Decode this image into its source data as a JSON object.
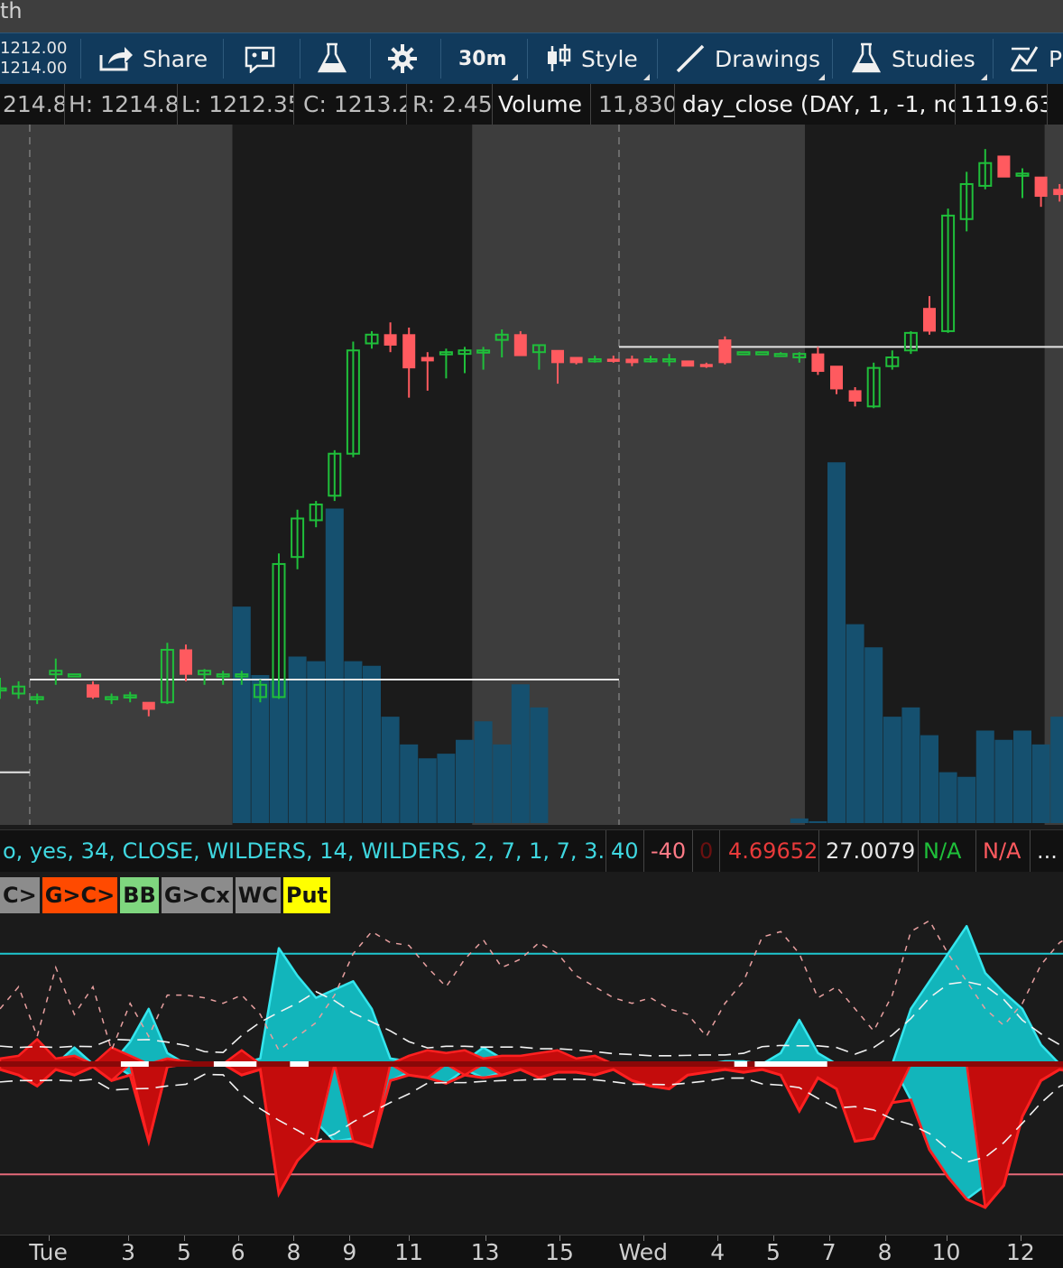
{
  "window": {
    "title_fragment": "th"
  },
  "toolbar": {
    "bid": "1212.00",
    "ask": "1214.00",
    "share_label": "Share",
    "timeframe_label": "30m",
    "style_label": "Style",
    "drawings_label": "Drawings",
    "studies_label": "Studies",
    "overflow_label": "P"
  },
  "info_bar": {
    "open": "214.8",
    "high": "H: 1214.8",
    "low": "L: 1212.35",
    "close": "C: 1213.2",
    "range": "R: 2.45",
    "volume_label": "Volume",
    "volume_value": "11,830",
    "study_label": "day_close (DAY, 1, -1, no)",
    "study_value": "1119.63"
  },
  "study_bar": {
    "params": "o, yes, 34, CLOSE, WILDERS, 14, WILDERS, 2, 7, 1, 7, 3.5, r",
    "v1": "40",
    "v2": "-40",
    "v3": "0",
    "v4": "4.69652",
    "v5": "27.0079",
    "v6": "N/A",
    "v7": "N/A",
    "more": "..."
  },
  "signal_labels": [
    {
      "text": "C>",
      "color": "#8c8c8c"
    },
    {
      "text": "G>C>",
      "color": "#ff4a00"
    },
    {
      "text": "BB",
      "color": "#7fd67f"
    },
    {
      "text": "G>Cx",
      "color": "#8c8c8c"
    },
    {
      "text": "WC",
      "color": "#8c8c8c"
    },
    {
      "text": "Put",
      "color": "#ffff00"
    }
  ],
  "icons": [
    "share-icon",
    "message-icon",
    "flask-icon",
    "gear-icon",
    "style-icon",
    "drawings-icon",
    "studies-icon",
    "pattern-icon"
  ],
  "colors": {
    "up": "#1fbf3a",
    "down": "#ff5a5f",
    "volume": "#15506f",
    "session_light": "#3d3d3d",
    "session_dark": "#1b1b1b",
    "osc_cyan": "#12b5bb",
    "osc_red": "#c40c0c",
    "upper_line": "#1ec8d0",
    "lower_line": "#e56a7a",
    "toolbar": "#113a5c"
  },
  "chart_data": {
    "type": "candlestick",
    "interval": "30m",
    "x_ticks": [
      "Tue",
      "3",
      "5",
      "6",
      "8",
      "9",
      "11",
      "13",
      "15",
      "Wed",
      "4",
      "5",
      "7",
      "8",
      "10",
      "12"
    ],
    "price_range": [
      1180,
      1220
    ],
    "reference_lines": [
      {
        "name": "day_close",
        "value": 1119.63
      }
    ],
    "candles": [
      {
        "o": 1187.8,
        "h": 1188.4,
        "l": 1187.2,
        "c": 1187.8
      },
      {
        "o": 1187.5,
        "h": 1188.2,
        "l": 1187.2,
        "c": 1187.9
      },
      {
        "o": 1187.3,
        "h": 1187.5,
        "l": 1186.9,
        "c": 1187.3
      },
      {
        "o": 1188.6,
        "h": 1189.5,
        "l": 1188.0,
        "c": 1188.8
      },
      {
        "o": 1188.6,
        "h": 1188.6,
        "l": 1188.6,
        "c": 1188.6
      },
      {
        "o": 1188.0,
        "h": 1188.2,
        "l": 1187.2,
        "c": 1187.3
      },
      {
        "o": 1187.3,
        "h": 1187.5,
        "l": 1186.9,
        "c": 1187.3
      },
      {
        "o": 1187.3,
        "h": 1187.6,
        "l": 1187.0,
        "c": 1187.4
      },
      {
        "o": 1187.0,
        "h": 1187.0,
        "l": 1186.2,
        "c": 1186.6
      },
      {
        "o": 1187.0,
        "h": 1190.4,
        "l": 1186.9,
        "c": 1190.0
      },
      {
        "o": 1190.0,
        "h": 1190.3,
        "l": 1188.2,
        "c": 1188.6
      },
      {
        "o": 1188.6,
        "h": 1188.9,
        "l": 1188.0,
        "c": 1188.8
      },
      {
        "o": 1188.6,
        "h": 1188.8,
        "l": 1188.0,
        "c": 1188.6
      },
      {
        "o": 1188.6,
        "h": 1188.8,
        "l": 1188.0,
        "c": 1188.6
      },
      {
        "o": 1187.3,
        "h": 1188.3,
        "l": 1187.0,
        "c": 1188.0
      },
      {
        "o": 1187.3,
        "h": 1195.5,
        "l": 1187.2,
        "c": 1194.9
      },
      {
        "o": 1195.3,
        "h": 1198.0,
        "l": 1194.6,
        "c": 1197.5
      },
      {
        "o": 1197.4,
        "h": 1198.5,
        "l": 1197.0,
        "c": 1198.3
      },
      {
        "o": 1198.8,
        "h": 1201.4,
        "l": 1198.5,
        "c": 1201.2
      },
      {
        "o": 1201.2,
        "h": 1207.6,
        "l": 1201.0,
        "c": 1207.1
      },
      {
        "o": 1207.5,
        "h": 1208.2,
        "l": 1207.2,
        "c": 1208.0
      },
      {
        "o": 1208.0,
        "h": 1208.7,
        "l": 1207.0,
        "c": 1207.4
      },
      {
        "o": 1208.0,
        "h": 1208.4,
        "l": 1204.4,
        "c": 1206.1
      },
      {
        "o": 1206.7,
        "h": 1207.0,
        "l": 1204.8,
        "c": 1206.5
      },
      {
        "o": 1206.9,
        "h": 1207.2,
        "l": 1205.5,
        "c": 1207.0
      },
      {
        "o": 1206.9,
        "h": 1207.3,
        "l": 1205.8,
        "c": 1207.1
      },
      {
        "o": 1207.0,
        "h": 1207.3,
        "l": 1206.0,
        "c": 1207.1
      },
      {
        "o": 1207.7,
        "h": 1208.3,
        "l": 1206.7,
        "c": 1208.0
      },
      {
        "o": 1208.0,
        "h": 1208.2,
        "l": 1206.8,
        "c": 1206.8
      },
      {
        "o": 1207.0,
        "h": 1207.4,
        "l": 1206.0,
        "c": 1207.4
      },
      {
        "o": 1207.1,
        "h": 1207.1,
        "l": 1205.2,
        "c": 1206.4
      },
      {
        "o": 1206.7,
        "h": 1206.7,
        "l": 1206.3,
        "c": 1206.4
      },
      {
        "o": 1206.6,
        "h": 1206.8,
        "l": 1206.4,
        "c": 1206.6
      },
      {
        "o": 1206.6,
        "h": 1206.8,
        "l": 1206.4,
        "c": 1206.5
      },
      {
        "o": 1206.6,
        "h": 1206.8,
        "l": 1206.2,
        "c": 1206.4
      },
      {
        "o": 1206.6,
        "h": 1206.8,
        "l": 1206.4,
        "c": 1206.6
      },
      {
        "o": 1206.5,
        "h": 1206.9,
        "l": 1206.2,
        "c": 1206.6
      },
      {
        "o": 1206.5,
        "h": 1206.5,
        "l": 1206.2,
        "c": 1206.2
      },
      {
        "o": 1206.3,
        "h": 1206.4,
        "l": 1206.1,
        "c": 1206.2
      },
      {
        "o": 1207.7,
        "h": 1207.9,
        "l": 1206.3,
        "c": 1206.4
      },
      {
        "o": 1207.0,
        "h": 1207.0,
        "l": 1207.0,
        "c": 1207.0
      },
      {
        "o": 1207.0,
        "h": 1207.0,
        "l": 1207.0,
        "c": 1207.0
      },
      {
        "o": 1206.9,
        "h": 1207.0,
        "l": 1206.9,
        "c": 1206.9
      },
      {
        "o": 1206.7,
        "h": 1207.0,
        "l": 1206.4,
        "c": 1206.9
      },
      {
        "o": 1206.9,
        "h": 1207.3,
        "l": 1205.7,
        "c": 1205.9
      },
      {
        "o": 1206.2,
        "h": 1206.2,
        "l": 1204.6,
        "c": 1204.9
      },
      {
        "o": 1204.8,
        "h": 1205.0,
        "l": 1203.9,
        "c": 1204.2
      },
      {
        "o": 1203.9,
        "h": 1206.4,
        "l": 1203.8,
        "c": 1206.1
      },
      {
        "o": 1206.2,
        "h": 1207.1,
        "l": 1206.0,
        "c": 1206.7
      },
      {
        "o": 1207.1,
        "h": 1208.2,
        "l": 1206.9,
        "c": 1208.1
      },
      {
        "o": 1209.5,
        "h": 1210.2,
        "l": 1208.0,
        "c": 1208.2
      },
      {
        "o": 1208.2,
        "h": 1215.2,
        "l": 1208.1,
        "c": 1214.8
      },
      {
        "o": 1214.6,
        "h": 1217.3,
        "l": 1213.9,
        "c": 1216.6
      },
      {
        "o": 1216.5,
        "h": 1218.6,
        "l": 1216.3,
        "c": 1217.8
      },
      {
        "o": 1218.2,
        "h": 1218.2,
        "l": 1217.0,
        "c": 1217.0
      },
      {
        "o": 1217.2,
        "h": 1217.5,
        "l": 1215.8,
        "c": 1217.2
      },
      {
        "o": 1217.0,
        "h": 1217.0,
        "l": 1215.3,
        "c": 1215.9
      },
      {
        "o": 1216.3,
        "h": 1216.6,
        "l": 1215.6,
        "c": 1216.0
      },
      {
        "o": 1216.5,
        "h": 1216.9,
        "l": 1215.2,
        "c": 1215.9
      },
      {
        "o": 1216.2,
        "h": 1216.3,
        "l": 1214.4,
        "c": 1214.6
      },
      {
        "o": 1214.8,
        "h": 1215.0,
        "l": 1213.6,
        "c": 1214.4
      },
      {
        "o": 1214.3,
        "h": 1216.9,
        "l": 1214.3,
        "c": 1216.5
      },
      {
        "o": 1216.3,
        "h": 1216.7,
        "l": 1215.7,
        "c": 1215.9
      },
      {
        "o": 1216.1,
        "h": 1216.4,
        "l": 1214.9,
        "c": 1216.0
      },
      {
        "o": 1216.2,
        "h": 1216.4,
        "l": 1215.1,
        "c": 1215.5
      },
      {
        "o": 1215.5,
        "h": 1215.8,
        "l": 1215.0,
        "c": 1215.2
      }
    ],
    "volume": [
      0,
      0,
      0,
      0,
      0,
      0,
      0,
      0,
      0,
      0,
      0,
      0,
      0,
      0,
      0,
      0,
      0,
      0,
      0,
      0,
      0,
      0,
      0,
      0,
      0,
      0,
      0,
      0,
      0,
      0,
      0,
      0,
      0,
      0,
      0,
      0,
      0,
      0,
      0,
      0,
      0,
      0,
      0,
      0,
      0,
      0,
      0,
      0,
      0,
      0,
      0,
      0,
      0,
      0,
      0,
      0,
      0,
      0,
      0,
      0,
      0,
      0,
      0,
      0,
      0,
      0
    ],
    "volume_visible": [
      2,
      3,
      0,
      0,
      0,
      0,
      2,
      2,
      3,
      0,
      1,
      0,
      0,
      1,
      3,
      3,
      2,
      3,
      2,
      8,
      4,
      0,
      2,
      1,
      0,
      2,
      1,
      1,
      1,
      0,
      3,
      1,
      1,
      0,
      4,
      3,
      2,
      0,
      0,
      0,
      0,
      0,
      0,
      0,
      0,
      0,
      0,
      0,
      0,
      0,
      0,
      0,
      0,
      0,
      0,
      0,
      0,
      0,
      0,
      0,
      0,
      0,
      0,
      0,
      0,
      0
    ],
    "oscillator": {
      "upper_level": 40,
      "lower_level": -40,
      "zero": 0,
      "range": [
        -55,
        55
      ],
      "cyan": [
        0,
        0,
        5,
        0,
        6,
        0,
        0,
        8,
        20,
        4,
        0,
        0,
        0,
        0,
        2,
        42,
        32,
        24,
        27,
        30,
        20,
        2,
        1,
        0,
        1,
        1,
        6,
        2,
        0,
        0,
        0,
        0,
        0,
        0,
        0,
        0,
        0,
        0,
        0,
        1,
        1,
        0,
        4,
        16,
        4,
        0,
        0,
        0,
        0,
        20,
        30,
        40,
        50,
        33,
        26,
        20,
        7,
        0,
        0,
        0,
        2,
        14,
        6,
        4,
        0,
        0
      ],
      "cyan_neg": [
        0,
        0,
        0,
        0,
        0,
        0,
        0,
        -4,
        -2,
        -1,
        0,
        0,
        0,
        0,
        -1,
        -43,
        -29,
        -21,
        -28,
        -27,
        -30,
        -6,
        -3,
        -5,
        -7,
        -2,
        -5,
        -3,
        -2,
        0,
        0,
        0,
        0,
        0,
        -4,
        -6,
        -5,
        -2,
        -1,
        0,
        0,
        0,
        -3,
        -17,
        -5,
        0,
        0,
        0,
        0,
        -13,
        -31,
        -41,
        -49,
        -44,
        -35,
        -17,
        -4,
        -1,
        0,
        0,
        -2,
        -10,
        -5,
        -4,
        -1,
        0
      ],
      "red": [
        2,
        3,
        9,
        2,
        3,
        0,
        6,
        3,
        0,
        2,
        1,
        0,
        0,
        5,
        0,
        0,
        0,
        0,
        0,
        0,
        0,
        0,
        3,
        5,
        4,
        5,
        2,
        3,
        3,
        4,
        5,
        2,
        3,
        0,
        0,
        0,
        0,
        0,
        0,
        0,
        0,
        0,
        0,
        0,
        0,
        0,
        0,
        0,
        0,
        0,
        0,
        0,
        0,
        0,
        0,
        0,
        0,
        0,
        0,
        0,
        0,
        0,
        0,
        0,
        0,
        0
      ],
      "red_neg": [
        -2,
        -4,
        -8,
        -2,
        -4,
        -1,
        -6,
        -2,
        -28,
        -1,
        0,
        0,
        0,
        -4,
        -2,
        -47,
        -35,
        -28,
        -22,
        -28,
        -30,
        -3,
        -4,
        -5,
        -3,
        -4,
        -3,
        -4,
        -2,
        -5,
        -3,
        -3,
        -4,
        -2,
        -6,
        -8,
        -9,
        -4,
        -3,
        -2,
        -3,
        -2,
        -4,
        -17,
        -5,
        -9,
        -28,
        -27,
        -14,
        -4,
        -30,
        -40,
        -48,
        -52,
        -44,
        -19,
        -6,
        -2,
        -3,
        -4,
        -2,
        -9,
        -8,
        -12,
        -2,
        -1
      ]
    }
  }
}
